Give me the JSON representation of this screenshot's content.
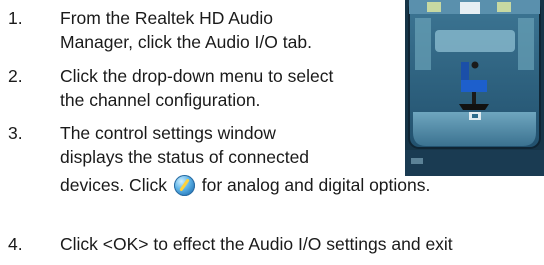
{
  "steps": [
    {
      "number": "1.",
      "lines": [
        "From the Realtek HD Audio",
        "Manager, click the Audio I/O tab."
      ]
    },
    {
      "number": "2.",
      "lines": [
        "Click the drop-down menu to select",
        "the channel configuration."
      ]
    },
    {
      "number": "3.",
      "lines": [
        "The control settings window",
        "displays the status of connected"
      ],
      "continuation_before_icon": "devices. Click",
      "continuation_after_icon": "for analog and digital options."
    },
    {
      "number": "4.",
      "lines": [
        "Click <OK> to effect the Audio I/O settings and exit"
      ]
    }
  ],
  "screenshot_icon": "audio-manager-screenshot",
  "inline_icon": "tool-settings-icon"
}
